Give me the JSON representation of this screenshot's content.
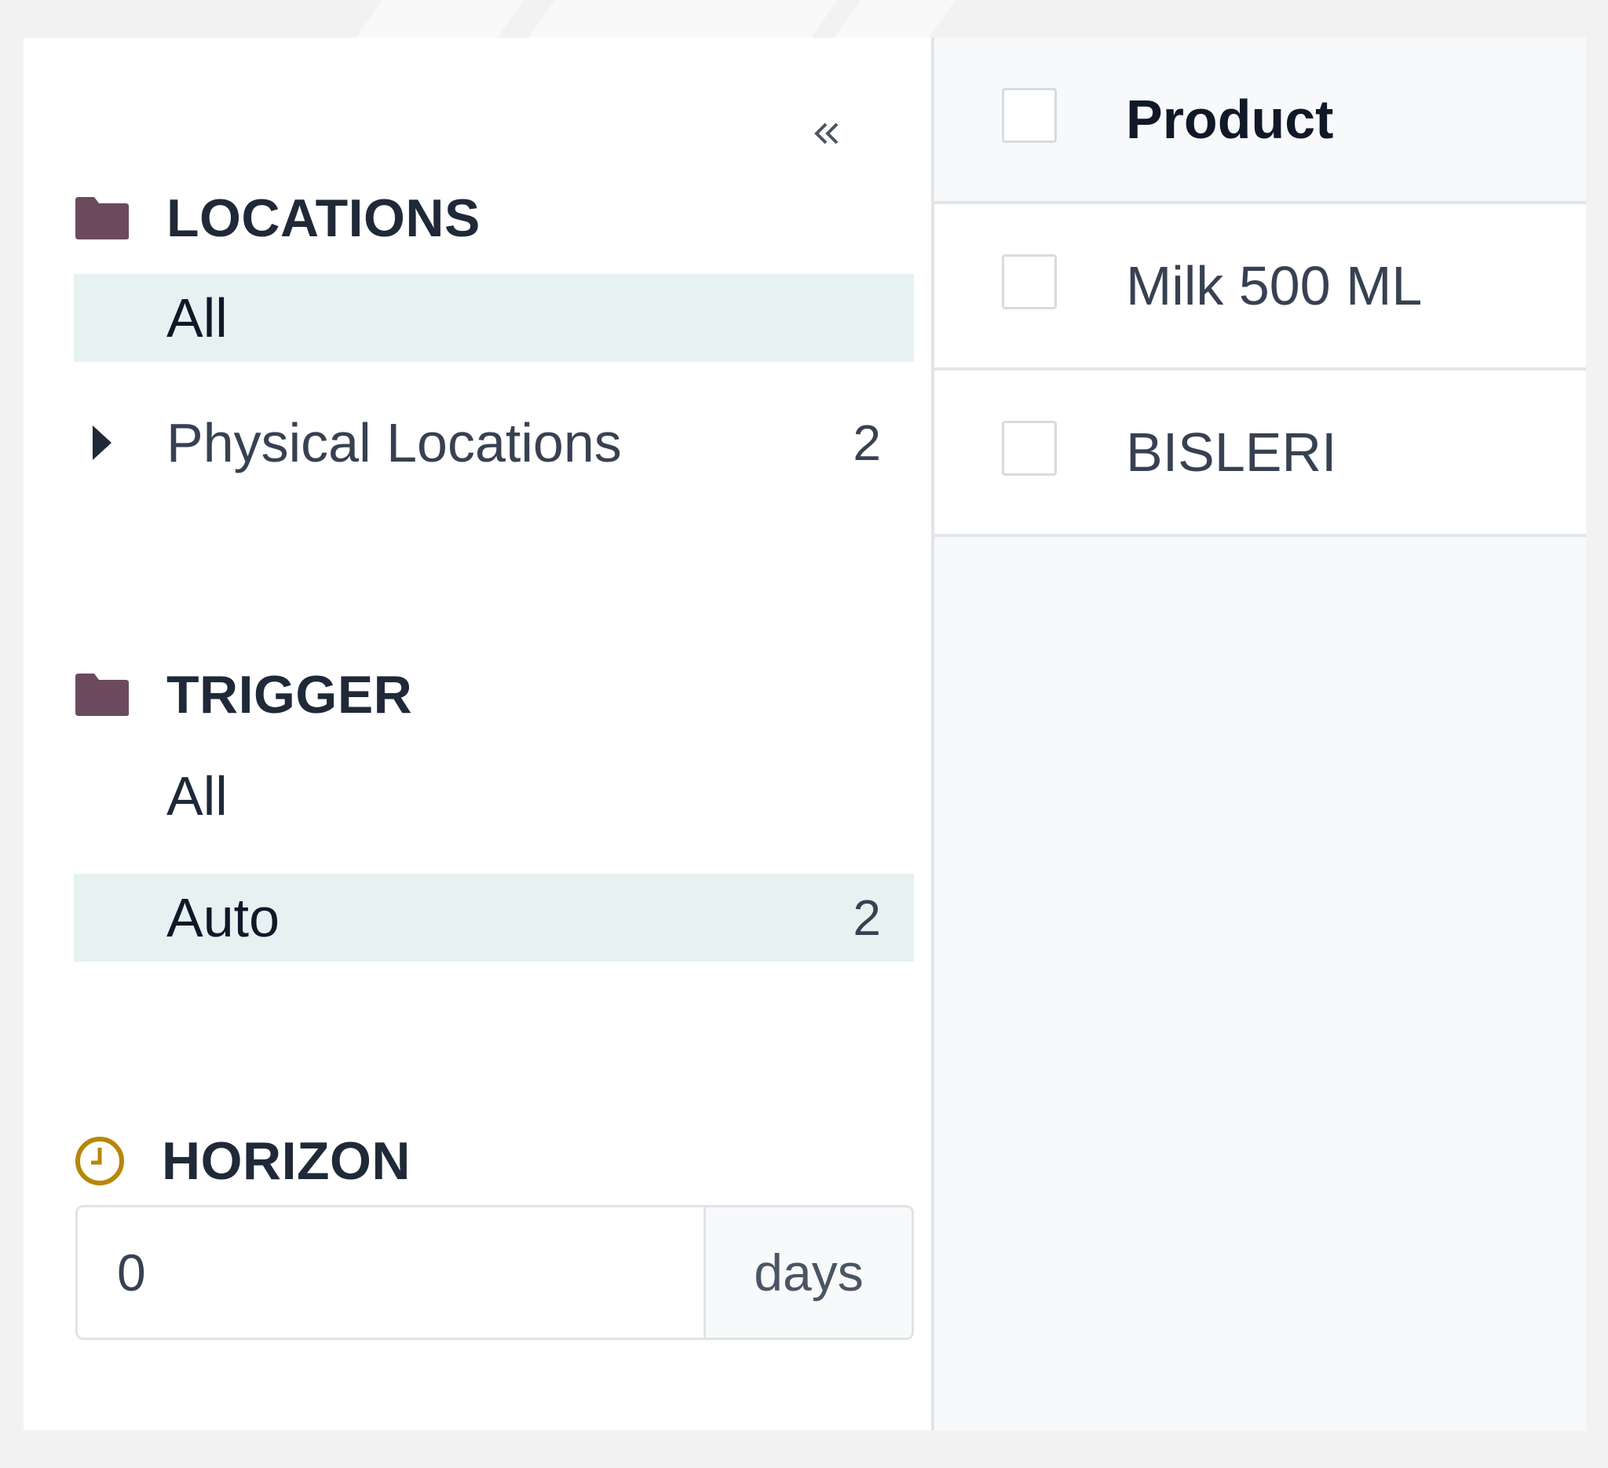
{
  "sidebar": {
    "collapse_icon": "double-chevron-left-icon",
    "locations": {
      "title": "LOCATIONS",
      "icon": "folder-icon",
      "items": [
        {
          "label": "All",
          "count": "",
          "active": true
        },
        {
          "label": "Physical Locations",
          "count": "2",
          "active": false,
          "expandable": true
        }
      ]
    },
    "trigger": {
      "title": "TRIGGER",
      "icon": "folder-icon",
      "items": [
        {
          "label": "All",
          "count": "",
          "active": false
        },
        {
          "label": "Auto",
          "count": "2",
          "active": true
        }
      ]
    },
    "horizon": {
      "title": "HORIZON",
      "icon": "clock-icon",
      "value": "0",
      "unit": "days"
    }
  },
  "list": {
    "header": {
      "label": "Product"
    },
    "rows": [
      {
        "product": "Milk 500 ML"
      },
      {
        "product": "BISLERI"
      }
    ]
  },
  "colors": {
    "folder": "#6b4a5e",
    "clock": "#b8860b",
    "active_bg": "#e6f2f2",
    "divider": "#e2e5e8"
  }
}
